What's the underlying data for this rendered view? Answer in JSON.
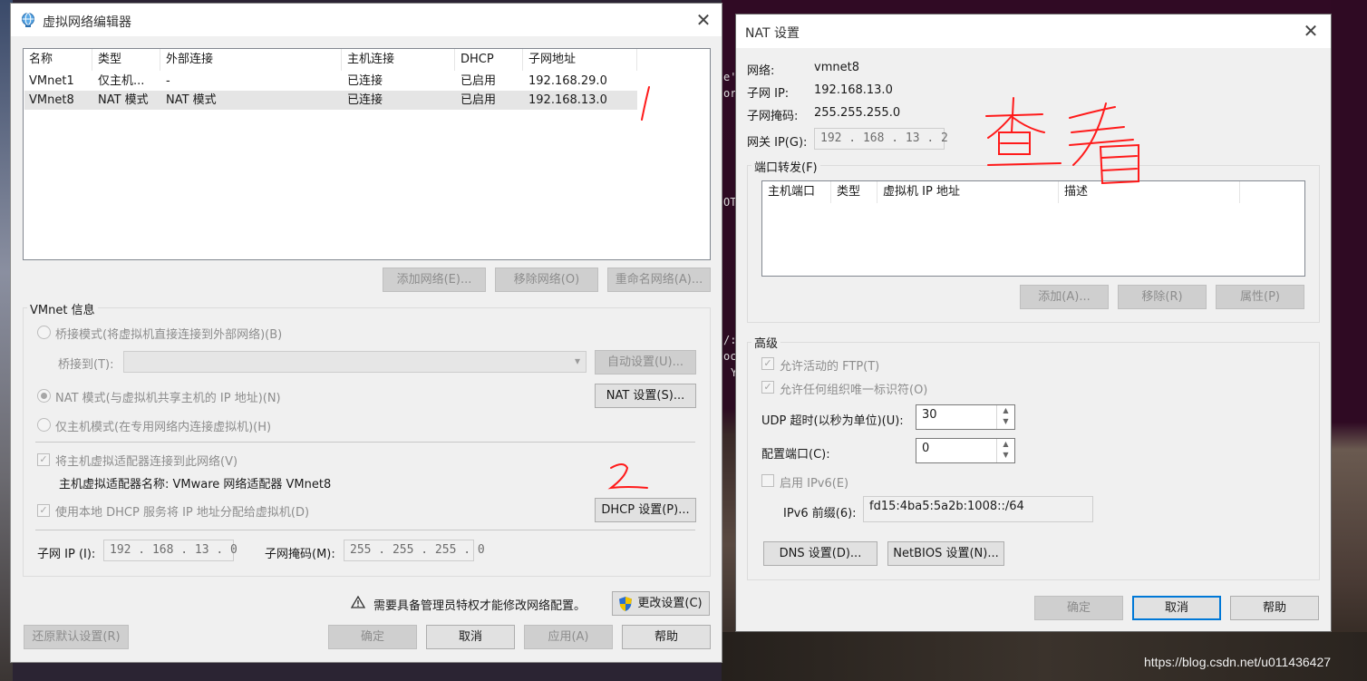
{
  "vne": {
    "title": "虚拟网络编辑器",
    "columns": [
      "名称",
      "类型",
      "外部连接",
      "主机连接",
      "DHCP",
      "子网地址"
    ],
    "rows": [
      [
        "VMnet1",
        "仅主机...",
        "-",
        "已连接",
        "已启用",
        "192.168.29.0"
      ],
      [
        "VMnet8",
        "NAT 模式",
        "NAT 模式",
        "已连接",
        "已启用",
        "192.168.13.0"
      ]
    ],
    "buttons": {
      "add_network": "添加网络(E)...",
      "remove_network": "移除网络(O)",
      "rename_network": "重命名网络(A)...",
      "auto_settings": "自动设置(U)...",
      "nat_settings": "NAT 设置(S)...",
      "dhcp_settings": "DHCP 设置(P)...",
      "change_settings": "更改设置(C)",
      "restore_defaults": "还原默认设置(R)",
      "ok": "确定",
      "cancel": "取消",
      "apply": "应用(A)",
      "help": "帮助"
    },
    "info_title": "VMnet 信息",
    "bridged_label": "桥接模式(将虚拟机直接连接到外部网络)(B)",
    "bridged_to_label": "桥接到(T):",
    "nat_label": "NAT 模式(与虚拟机共享主机的 IP 地址)(N)",
    "host_only_label": "仅主机模式(在专用网络内连接虚拟机)(H)",
    "connect_adapter_label": "将主机虚拟适配器连接到此网络(V)",
    "adapter_name": "主机虚拟适配器名称: VMware 网络适配器 VMnet8",
    "dhcp_label": "使用本地 DHCP 服务将 IP 地址分配给虚拟机(D)",
    "subnet_ip_label": "子网 IP (I):",
    "subnet_ip_value": "192 . 168 . 13 . 0",
    "subnet_mask_label": "子网掩码(M):",
    "subnet_mask_value": "255 . 255 . 255 . 0",
    "admin_notice": "需要具备管理员特权才能修改网络配置。",
    "selected_mode": "nat",
    "connect_adapter_checked": true,
    "dhcp_checked": true
  },
  "nat": {
    "title": "NAT 设置",
    "network_label": "网络:",
    "network_value": "vmnet8",
    "subnet_ip_label": "子网 IP:",
    "subnet_ip_value": "192.168.13.0",
    "subnet_mask_label": "子网掩码:",
    "subnet_mask_value": "255.255.255.0",
    "gateway_label": "网关 IP(G):",
    "gateway_value": "192 . 168 . 13 . 2",
    "port_forward_title": "端口转发(F)",
    "pf_columns": [
      "主机端口",
      "类型",
      "虚拟机 IP 地址",
      "描述"
    ],
    "pf_buttons": {
      "add": "添加(A)...",
      "remove": "移除(R)",
      "properties": "属性(P)"
    },
    "advanced_title": "高级",
    "allow_ftp_label": "允许活动的 FTP(T)",
    "allow_oui_label": "允许任何组织唯一标识符(O)",
    "udp_timeout_label": "UDP 超时(以秒为单位)(U):",
    "udp_timeout_value": "30",
    "config_port_label": "配置端口(C):",
    "config_port_value": "0",
    "enable_ipv6_label": "启用 IPv6(E)",
    "ipv6_prefix_label": "IPv6 前缀(6):",
    "ipv6_prefix_value": "fd15:4ba5:5a2b:1008::/64",
    "dns_button": "DNS 设置(D)...",
    "netbios_button": "NetBIOS 设置(N)...",
    "ok": "确定",
    "cancel": "取消",
    "help": "帮助"
  },
  "annotations": {
    "mark1": "1",
    "mark2": "2",
    "chinese": "查看"
  },
  "watermark": "https://blog.csdn.net/u011436427",
  "colors": {
    "accent": "#0078d7",
    "annotation": "#ff1a1a",
    "terminal_bg": "#300a24"
  },
  "icons": {
    "title_icon": "network-globe-icon",
    "shield": "uac-shield-icon",
    "warning": "warning-icon"
  }
}
